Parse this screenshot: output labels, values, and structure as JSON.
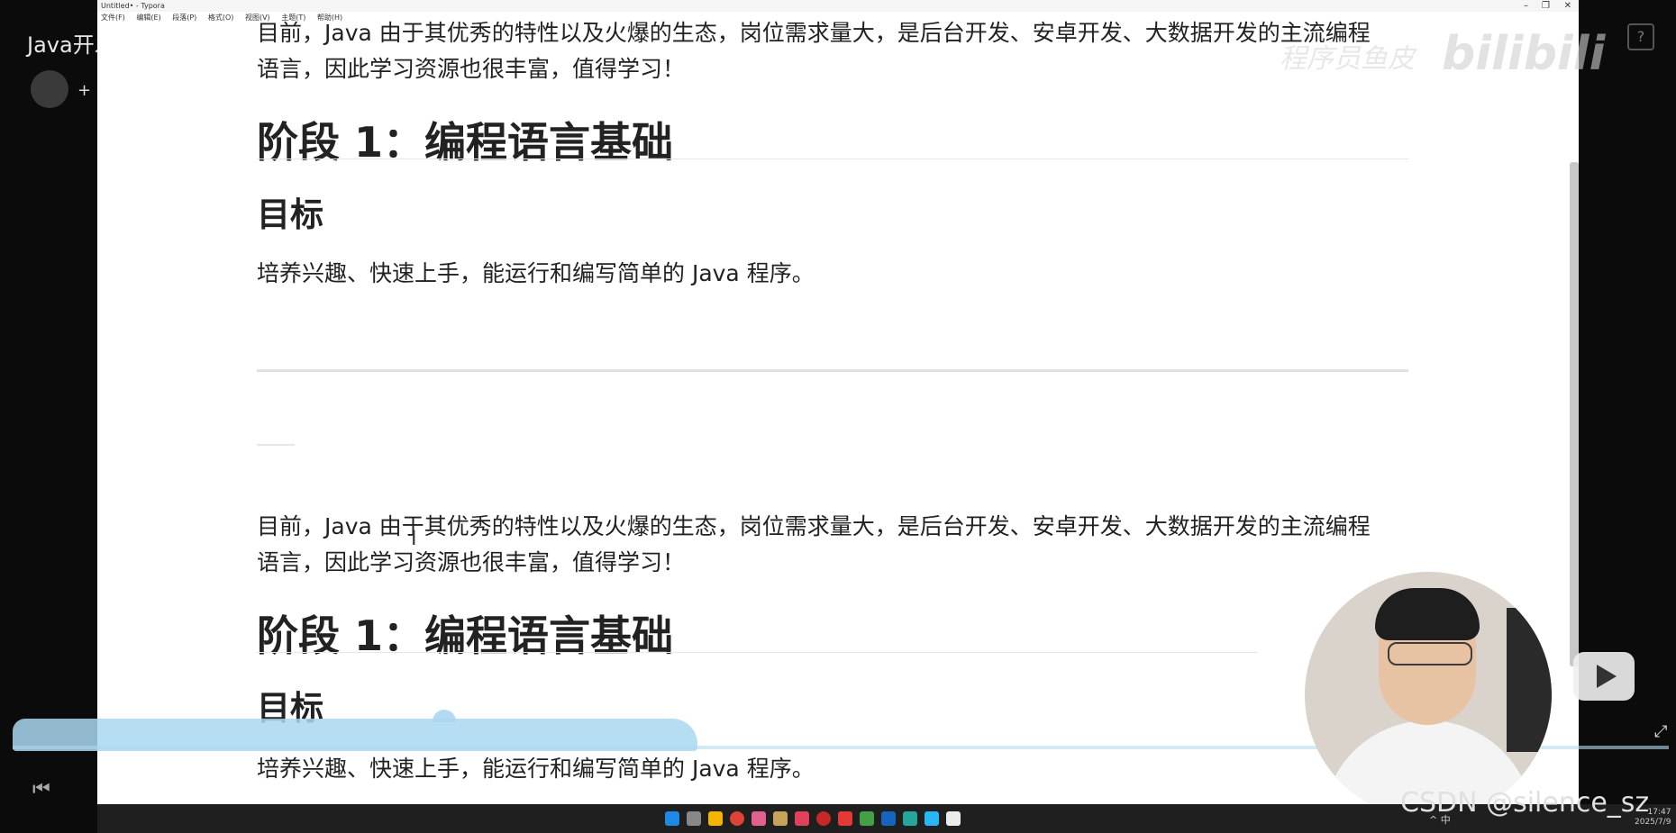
{
  "background": {
    "video_title": "Java开发AI项目，大家",
    "follow_label": "+ 关注",
    "badge": "?"
  },
  "window": {
    "title": "Untitled• - Typora",
    "menu": [
      "文件(F)",
      "编辑(E)",
      "段落(P)",
      "格式(O)",
      "视图(V)",
      "主题(T)",
      "帮助(H)"
    ],
    "controls": [
      "–",
      "❐",
      "✕"
    ]
  },
  "document": {
    "para_top": "目前，Java 由于其优秀的特性以及火爆的生态，岗位需求量大，是后台开发、安卓开发、大数据开发的主流编程语言，因此学习资源也很丰富，值得学习！",
    "stage1_heading": "阶段 1：编程语言基础",
    "goal_heading": "目标",
    "goal_text": "培养兴趣、快速上手，能运行和编写简单的 Java 程序。",
    "para_second": "目前，Java 由于其优秀的特性以及火爆的生态，岗位需求量大，是后台开发、安卓开发、大数据开发的主流编程语言，因此学习资源也很丰富，值得学习！",
    "stage1_heading_2": "阶段 1：编程语言基础",
    "goal_heading_2": "目标",
    "goal_text_2": "培养兴趣、快速上手，能运行和编写简单的 Java 程序。"
  },
  "overlay": {
    "watermark": "程序员鱼皮",
    "bili_logo": "bilibili",
    "csdn": "CSDN @silence_sz"
  },
  "taskbar": {
    "tray_text": "^ 中",
    "time": "17:47",
    "date": "2025/7/9"
  },
  "colors": {
    "accent_wave": "#aad7f0",
    "taskbar_bg": "#1f1f1f"
  }
}
